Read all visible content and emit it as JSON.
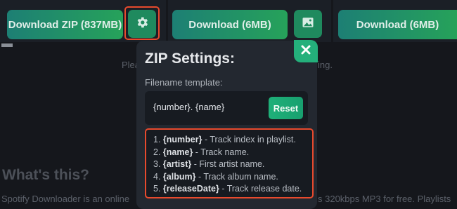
{
  "buttons": {
    "zip": "Download ZIP (837MB)",
    "track1": "Download (6MB)",
    "track2": "Download (6MB)"
  },
  "icons": {
    "settings": "gear-icon",
    "image": "image-icon",
    "close": "close-icon"
  },
  "background": {
    "hint_left": "Plea",
    "hint_right": "ing.",
    "heading": "What's this?",
    "intro_left": "Spotify Downloader is an online",
    "intro_right": "s 320kbps MP3 for free. Playlists"
  },
  "zip_settings": {
    "title": "ZIP Settings:",
    "template_label": "Filename template:",
    "template_value": "{number}. {name}",
    "reset_label": "Reset",
    "variables": [
      {
        "index": "1.",
        "name": "{number}",
        "desc": " - Track index in playlist."
      },
      {
        "index": "2.",
        "name": "{name}",
        "desc": " - Track name."
      },
      {
        "index": "3.",
        "name": "{artist}",
        "desc": " - First artist name."
      },
      {
        "index": "4.",
        "name": "{album}",
        "desc": " - Track album name."
      },
      {
        "index": "5.",
        "name": "{releaseDate}",
        "desc": " - Track release date."
      }
    ]
  },
  "colors": {
    "accent": "#24b07b",
    "highlight": "#e84a2d",
    "background": "#15171c"
  }
}
